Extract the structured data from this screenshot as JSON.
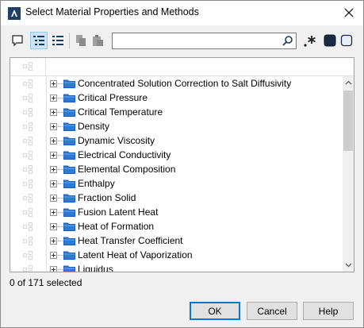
{
  "window": {
    "title": "Select Material Properties and Methods",
    "app_icon": "simcenter-icon",
    "close_icon": "close-icon"
  },
  "toolbar": {
    "buttons": [
      {
        "icon": "comment-icon",
        "active": false
      },
      {
        "icon": "list-tree-icon",
        "active": true
      },
      {
        "icon": "list-bullets-icon",
        "active": false
      },
      {
        "icon": "copy-icon",
        "active": false,
        "disabled": true
      },
      {
        "icon": "paste-icon",
        "active": false,
        "disabled": true
      },
      {
        "icon": "regex-icon",
        "active": false
      },
      {
        "icon": "dark-square-icon",
        "active": false
      },
      {
        "icon": "light-square-icon",
        "active": false
      }
    ],
    "search_value": "",
    "search_placeholder": ""
  },
  "tree": {
    "items": [
      {
        "label": "Concentrated Solution Correction to Salt Diffusivity"
      },
      {
        "label": "Critical Pressure"
      },
      {
        "label": "Critical Temperature"
      },
      {
        "label": "Density"
      },
      {
        "label": "Dynamic Viscosity"
      },
      {
        "label": "Electrical Conductivity"
      },
      {
        "label": "Elemental Composition"
      },
      {
        "label": "Enthalpy"
      },
      {
        "label": "Fraction Solid"
      },
      {
        "label": "Fusion Latent Heat"
      },
      {
        "label": "Heat of Formation"
      },
      {
        "label": "Heat Transfer Coefficient"
      },
      {
        "label": "Latent Heat of Vaporization"
      },
      {
        "label": "Liquidus"
      }
    ]
  },
  "status": {
    "text": "0 of 171 selected"
  },
  "buttons": {
    "ok": "OK",
    "cancel": "Cancel",
    "help": "Help"
  },
  "colors": {
    "folder": "#2b7bd6",
    "accent": "#0078d7"
  }
}
